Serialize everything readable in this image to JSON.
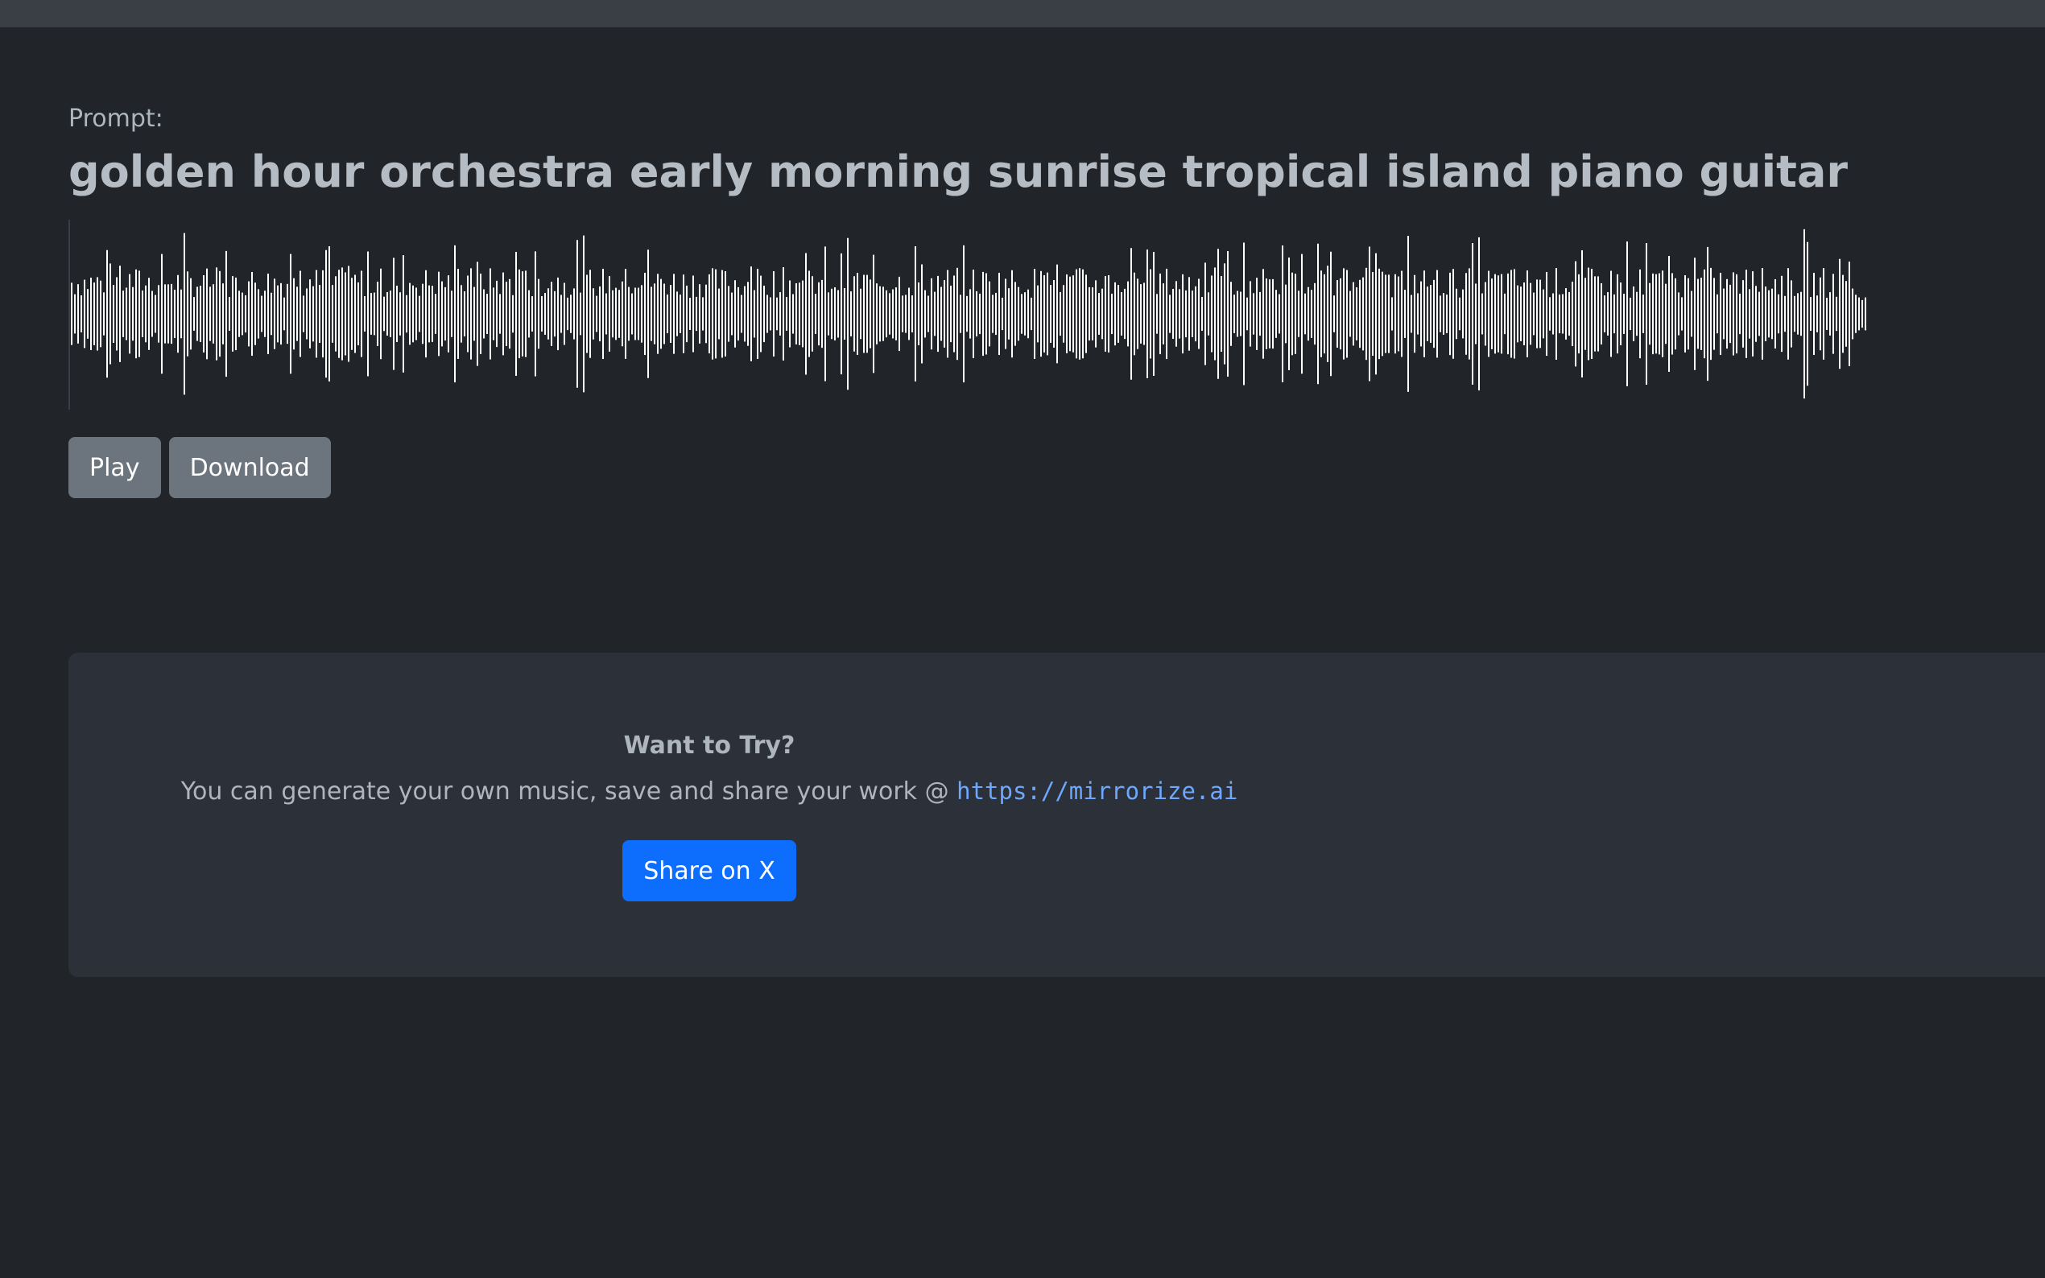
{
  "prompt": {
    "label": "Prompt:",
    "title": "golden hour orchestra early morning sunrise tropical island piano guitar"
  },
  "player": {
    "play_label": "Play",
    "download_label": "Download",
    "waveform_color": "#ffffff"
  },
  "promo": {
    "heading": "Want to Try?",
    "text": "You can generate your own music, save and share your work @ ",
    "link_text": "https://mirrorize.ai",
    "share_label": "Share on X"
  },
  "colors": {
    "background": "#212529",
    "card": "#2c3038",
    "primary": "#0d6efd",
    "secondary": "#6c757d",
    "link": "#6ea8fe"
  }
}
